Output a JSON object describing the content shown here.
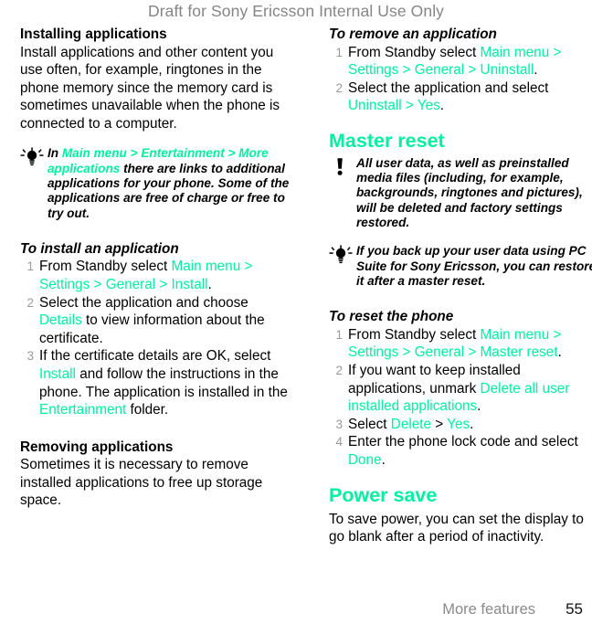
{
  "header": {
    "draft_notice": "Draft for Sony Ericsson Internal Use Only"
  },
  "left_column": {
    "installing": {
      "heading": "Installing applications",
      "body": "Install applications and other content you use often, for example, ringtones in the phone memory since the memory card is sometimes unavailable when the phone is connected to a computer."
    },
    "tip_note": {
      "icon": "lightbulb-icon",
      "lead": "In ",
      "path": "Main menu > Entertainment > More applications",
      "rest": " there are links to additional applications for your phone. Some of the applications are free of charge or free to try out."
    },
    "install_procedure": {
      "title": "To install an application",
      "steps": [
        {
          "num": "1",
          "pre": "From Standby select ",
          "path": "Main menu > Settings > General > Install",
          "post": "."
        },
        {
          "num": "2",
          "pre": "Select the application and choose ",
          "path": "Details",
          "post": " to view information about the certificate."
        },
        {
          "num": "3",
          "pre": "If the certificate details are OK, select ",
          "path": "Install",
          "post": " and follow the instructions in the phone. The application is installed in the ",
          "path2": "Entertainment",
          "post2": " folder."
        }
      ]
    },
    "removing": {
      "heading": "Removing applications",
      "body": "Sometimes it is necessary to remove installed applications to free up storage space."
    }
  },
  "right_column": {
    "remove_procedure": {
      "title": "To remove an application",
      "steps": [
        {
          "num": "1",
          "pre": "From Standby select ",
          "path": "Main menu > Settings > General > Uninstall",
          "post": "."
        },
        {
          "num": "2",
          "pre": "Select the application and select ",
          "path": "Uninstall > Yes",
          "post": "."
        }
      ]
    },
    "master_reset": {
      "heading": "Master reset",
      "warning": {
        "icon": "exclamation-icon",
        "text": "All user data, as well as preinstalled media files (including, for example, backgrounds, ringtones and pictures), will be deleted and factory settings restored."
      },
      "tip": {
        "icon": "lightbulb-icon",
        "text": "If you back up your user data using PC Suite for Sony Ericsson, you can restore it after a master reset."
      },
      "reset_procedure": {
        "title": "To reset the phone",
        "steps": [
          {
            "num": "1",
            "pre": "From Standby select ",
            "path": "Main menu > Settings > General > Master reset",
            "post": "."
          },
          {
            "num": "2",
            "pre": "If you want to keep installed applications, unmark ",
            "path": "Delete all user installed applications",
            "post": "."
          },
          {
            "num": "3",
            "pre": "Select ",
            "path": "Delete",
            "mid": " > ",
            "path2": "Yes",
            "post": "."
          },
          {
            "num": "4",
            "pre": "Enter the phone lock code and select ",
            "path": "Done",
            "post": "."
          }
        ]
      }
    },
    "power_save": {
      "heading": "Power save",
      "body": "To save power, you can set the display to go blank after a period of inactivity."
    }
  },
  "footer": {
    "chapter": "More features",
    "page_number": "55"
  },
  "colors": {
    "accent_green": "#00efa0",
    "draft_gray": "#858585",
    "step_number_gray": "#9a9a9a",
    "footer_gray": "#8a8a8a"
  }
}
